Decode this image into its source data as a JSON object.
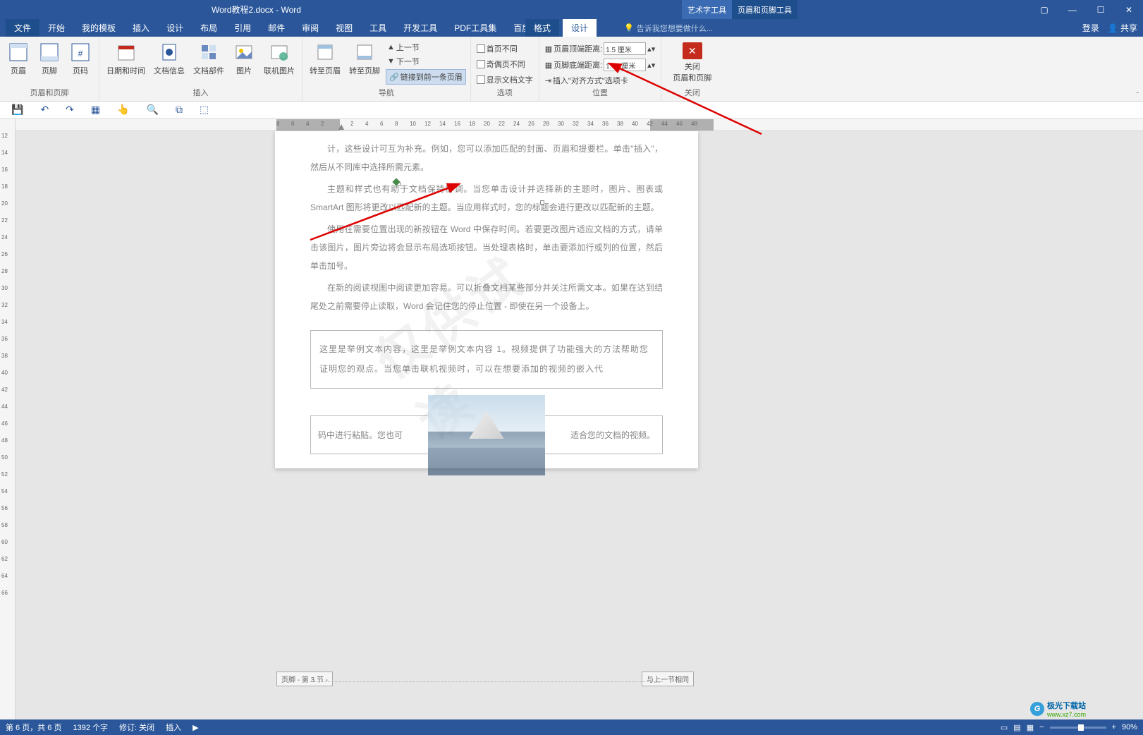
{
  "title": "Word教程2.docx - Word",
  "contextual": {
    "art": "艺术字工具",
    "hf": "页眉和页脚工具"
  },
  "tabs": {
    "file": "文件",
    "home": "开始",
    "mytpl": "我的模板",
    "insert": "插入",
    "design": "设计",
    "layout": "布局",
    "ref": "引用",
    "mail": "邮件",
    "review": "审阅",
    "view": "视图",
    "tools": "工具",
    "dev": "开发工具",
    "pdf": "PDF工具集",
    "baidu": "百度网盘",
    "format": "格式",
    "design2": "设计"
  },
  "tellme": "告诉我您想要做什么...",
  "login": "登录",
  "share": "共享",
  "ribbon": {
    "hf_group": "页眉和页脚",
    "header": "页眉",
    "footer": "页脚",
    "pagenum": "页码",
    "insert_group": "插入",
    "datetime": "日期和时间",
    "docinfo": "文档信息",
    "docparts": "文档部件",
    "pic": "图片",
    "onlinepic": "联机图片",
    "nav_group": "导航",
    "goto_header": "转至页眉",
    "goto_footer": "转至页脚",
    "prev": "上一节",
    "next": "下一节",
    "link_prev": "链接到前一条页眉",
    "opts_group": "选项",
    "diff_first": "首页不同",
    "diff_oddeven": "奇偶页不同",
    "show_doc": "显示文档文字",
    "pos_group": "位置",
    "hdr_from_top": "页眉顶端距离:",
    "ftr_from_bot": "页脚底端距离:",
    "insert_align": "插入\"对齐方式\"选项卡",
    "hdr_dist_val": "1.5 厘米",
    "ftr_dist_val": "1.75 厘米",
    "close_group": "关闭",
    "close_btn1": "关闭",
    "close_btn2": "页眉和页脚"
  },
  "ruler_h": [
    "8",
    "6",
    "4",
    "2",
    "",
    "2",
    "4",
    "6",
    "8",
    "10",
    "12",
    "14",
    "16",
    "18",
    "20",
    "22",
    "24",
    "26",
    "28",
    "30",
    "32",
    "34",
    "36",
    "38",
    "40",
    "42",
    "44",
    "46",
    "48"
  ],
  "ruler_v": [
    "12",
    "14",
    "16",
    "18",
    "20",
    "22",
    "24",
    "26",
    "28",
    "30",
    "32",
    "34",
    "36",
    "38",
    "40",
    "42",
    "44",
    "46",
    "48",
    "50",
    "52",
    "54",
    "56",
    "58",
    "60",
    "62",
    "64",
    "66"
  ],
  "doc": {
    "p1": "计，这些设计可互为补充。例如，您可以添加匹配的封面、页眉和提要栏。单击\"插入\"，然后从不同库中选择所需元素。",
    "p2": "主题和样式也有助于文档保持协调。当您单击设计并选择新的主题时，图片、图表或 SmartArt 图形将更改以匹配新的主题。当应用样式时，您的标题会进行更改以匹配新的主题。",
    "p3": "使用在需要位置出现的新按钮在 Word 中保存时间。若要更改图片适应文档的方式，请单击该图片，图片旁边将会显示布局选项按钮。当处理表格时，单击要添加行或列的位置，然后单击加号。",
    "p4": "在新的阅读视图中阅读更加容易。可以折叠文档某些部分并关注所需文本。如果在达到结尾处之前需要停止读取，Word 会记住您的停止位置 - 即使在另一个设备上。",
    "box1": "这里是举例文本内容，这里是举例文本内容 1。视频提供了功能强大的方法帮助您证明您的观点。当您单击联机视频时，可以在想要添加的视频的嵌入代",
    "box2_l": "码中进行粘贴。您也可",
    "box2_r": "适合您的文档的视频。"
  },
  "watermark": "仅供试读",
  "footer_left": "页脚 - 第 3 节 -",
  "footer_right": "与上一节相同",
  "status": {
    "page": "第 6 页，共 6 页",
    "words": "1392 个字",
    "track": "修订: 关闭",
    "insert": "插入",
    "zoom": "90%"
  },
  "brand": {
    "name": "极光下载站",
    "url": "www.xz7.com"
  }
}
